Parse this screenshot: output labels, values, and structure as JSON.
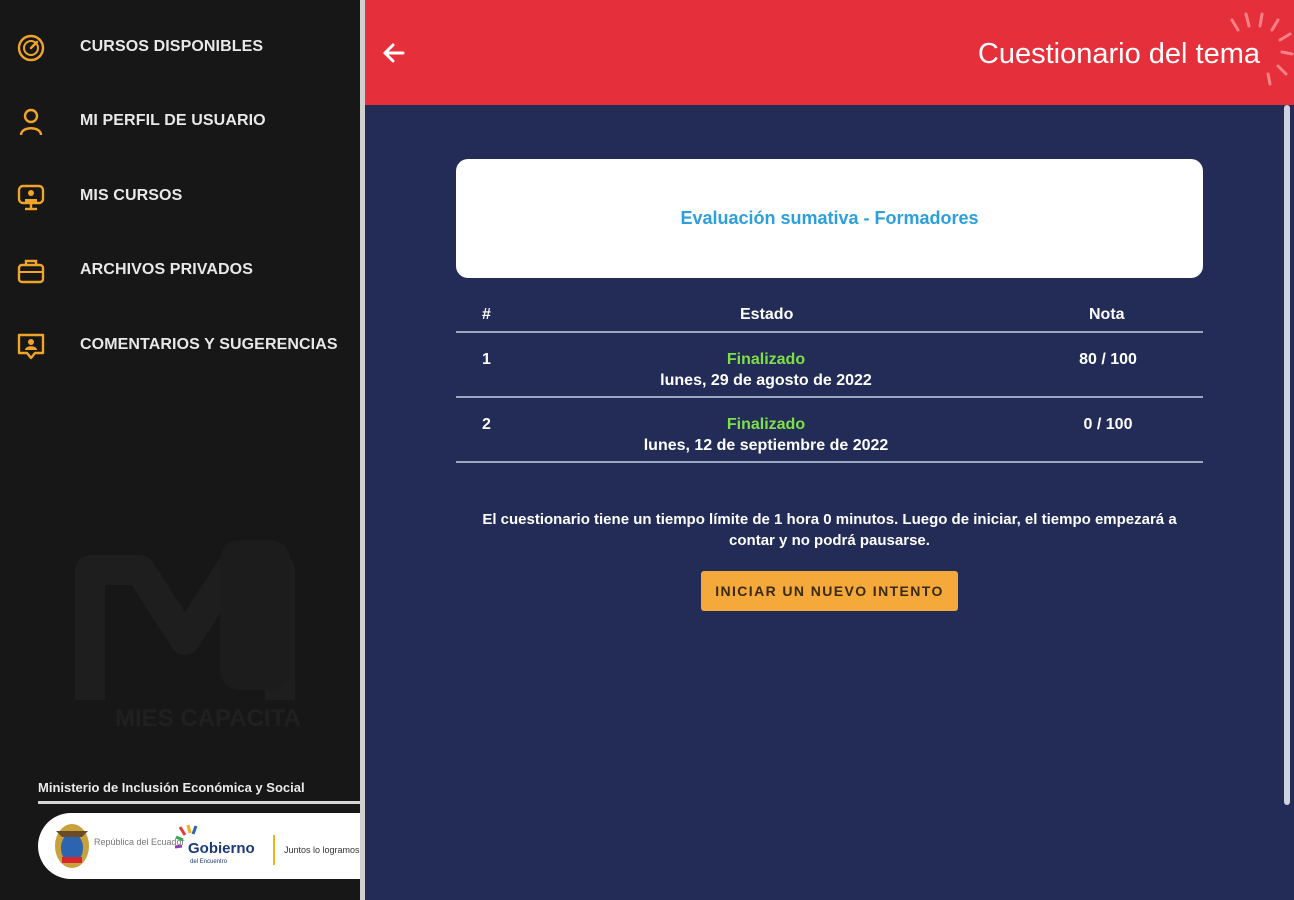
{
  "sidebar": {
    "items": [
      {
        "icon": "speedometer-icon",
        "label": "CURSOS DISPONIBLES"
      },
      {
        "icon": "user-icon",
        "label": "MI PERFIL DE USUARIO"
      },
      {
        "icon": "monitor-icon",
        "label": "MIS CURSOS"
      },
      {
        "icon": "briefcase-icon",
        "label": "ARCHIVOS PRIVADOS"
      },
      {
        "icon": "feedback-icon",
        "label": "COMENTARIOS Y SUGERENCIAS"
      }
    ],
    "ministry": "Ministerio de Inclusión Económica y Social",
    "logo_text": {
      "republica": "República del Ecuador",
      "gobierno": "Gobierno",
      "encuentro": "del Encuentro",
      "juntos": "Juntos lo logramos",
      "watermark": "MIES CAPACITA"
    },
    "icon_color": "#f0a52a"
  },
  "header": {
    "title": "Cuestionario del tema",
    "back": "back-arrow-icon",
    "color": "#e5303b"
  },
  "main": {
    "quiz_name": "Evaluación sumativa - Formadores",
    "table": {
      "headers": {
        "num": "#",
        "state": "Estado",
        "grade": "Nota"
      },
      "rows": [
        {
          "num": "1",
          "state": "Finalizado",
          "date": "lunes, 29 de agosto de 2022",
          "grade": "80 / 100"
        },
        {
          "num": "2",
          "state": "Finalizado",
          "date": "lunes, 12 de septiembre de 2022",
          "grade": "0 / 100"
        }
      ]
    },
    "info": "El cuestionario tiene un tiempo límite de 1 hora 0 minutos. Luego de iniciar, el tiempo empezará a contar y no podrá pausarse.",
    "button": "INICIAR UN NUEVO INTENTO",
    "accent": "#f5a93a",
    "status_color": "#7ee047"
  }
}
